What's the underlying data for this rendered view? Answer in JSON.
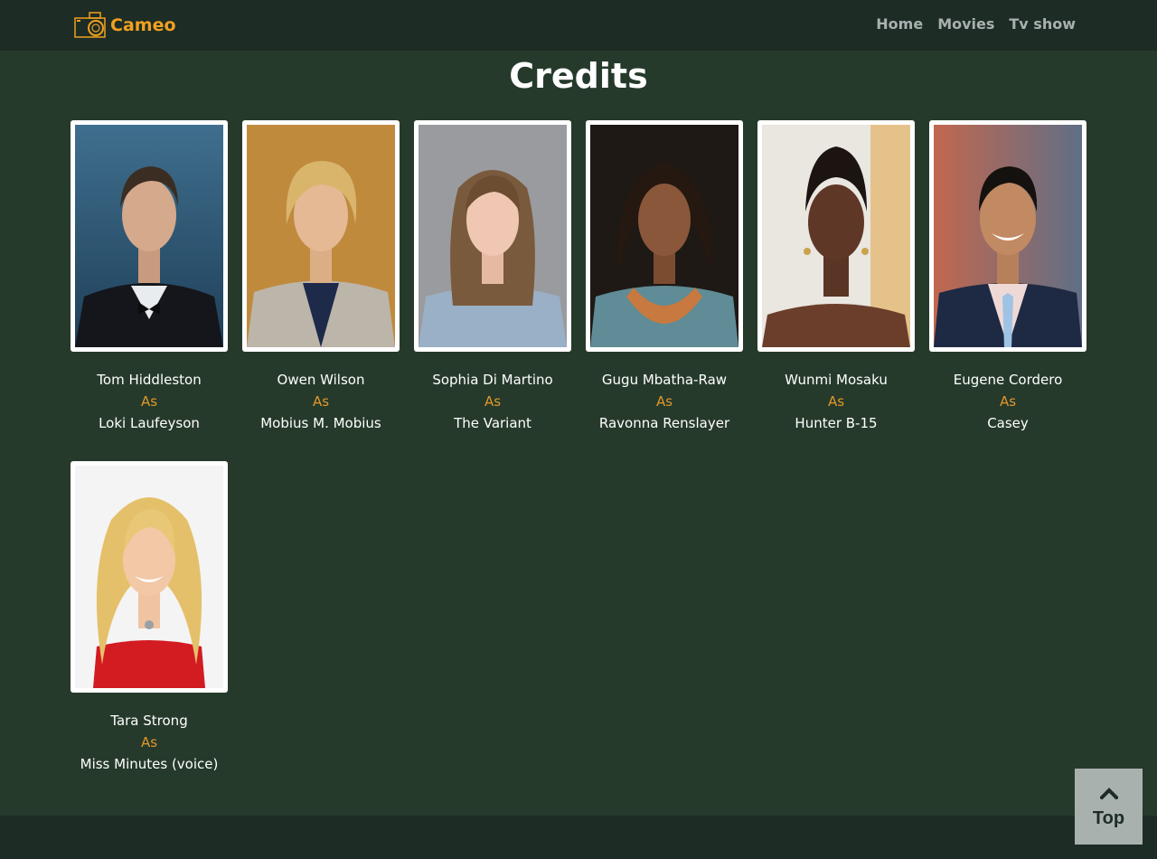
{
  "brand": {
    "name": "Cameo",
    "color": "#f0a01f",
    "icon": "camera-icon"
  },
  "nav": {
    "links": [
      "Home",
      "Movies",
      "Tv show"
    ]
  },
  "page": {
    "title": "Credits"
  },
  "cast": [
    {
      "actor": "Tom Hiddleston",
      "as": "As",
      "character": "Loki Laufeyson"
    },
    {
      "actor": "Owen Wilson",
      "as": "As",
      "character": "Mobius M. Mobius"
    },
    {
      "actor": "Sophia Di Martino",
      "as": "As",
      "character": "The Variant"
    },
    {
      "actor": "Gugu Mbatha-Raw",
      "as": "As",
      "character": "Ravonna Renslayer"
    },
    {
      "actor": "Wunmi Mosaku",
      "as": "As",
      "character": "Hunter B-15"
    },
    {
      "actor": "Eugene Cordero",
      "as": "As",
      "character": "Casey"
    },
    {
      "actor": "Tara Strong",
      "as": "As",
      "character": "Miss Minutes (voice)"
    }
  ],
  "back_to_top": {
    "label": "Top",
    "icon": "chevron-up-icon"
  },
  "colors": {
    "background": "#263a2b",
    "navbar": "#1d2c25",
    "accent": "#e0982a"
  }
}
